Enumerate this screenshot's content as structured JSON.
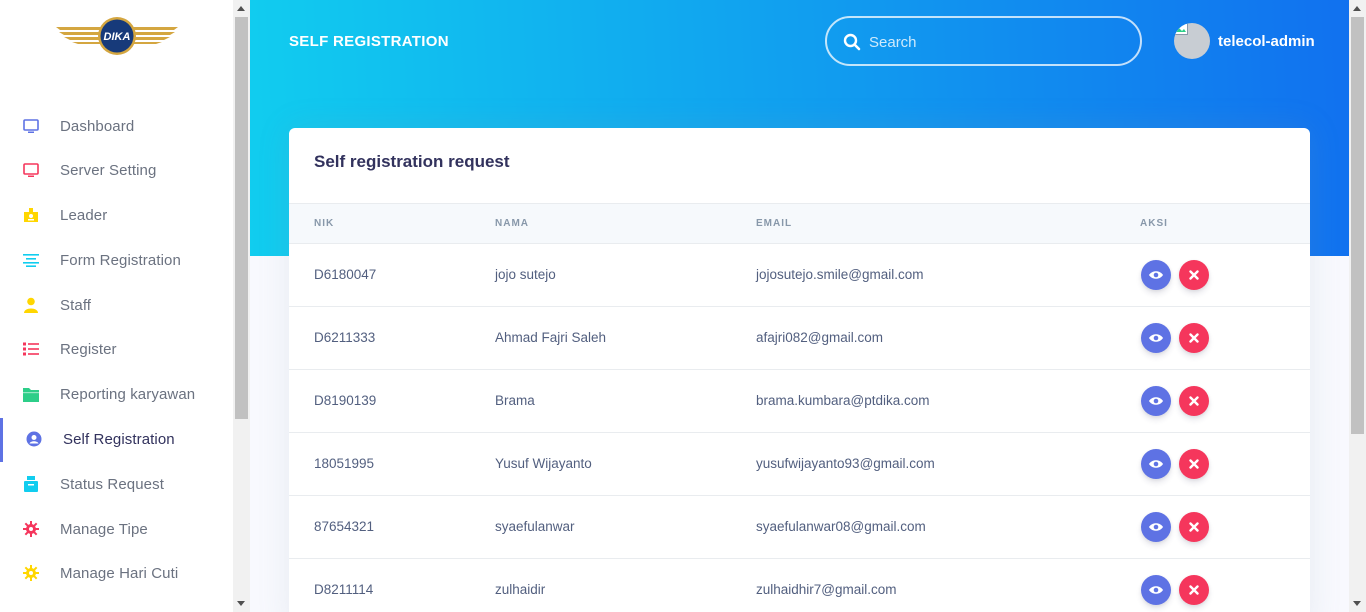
{
  "brand": {
    "logo_text": "DIKA"
  },
  "sidebar": {
    "items": [
      {
        "label": "Dashboard",
        "icon": "monitor-icon",
        "color": "#5e72e4"
      },
      {
        "label": "Server Setting",
        "icon": "monitor-icon",
        "color": "#f5365c"
      },
      {
        "label": "Leader",
        "icon": "badge-icon",
        "color": "#ffd600"
      },
      {
        "label": "Form Registration",
        "icon": "align-icon",
        "color": "#11cdef"
      },
      {
        "label": "Staff",
        "icon": "user-icon",
        "color": "#ffd600"
      },
      {
        "label": "Register",
        "icon": "list-icon",
        "color": "#f5365c"
      },
      {
        "label": "Reporting karyawan",
        "icon": "folder-icon",
        "color": "#2dce89"
      },
      {
        "label": "Self Registration",
        "icon": "user-circle-icon",
        "color": "#5e72e4",
        "active": true
      },
      {
        "label": "Status Request",
        "icon": "archive-icon",
        "color": "#11cdef"
      },
      {
        "label": "Manage Tipe",
        "icon": "gear-icon",
        "color": "#f5365c"
      },
      {
        "label": "Manage Hari Cuti",
        "icon": "gear-icon",
        "color": "#ffd600"
      }
    ]
  },
  "header": {
    "title": "SELF REGISTRATION",
    "search_placeholder": "Search",
    "username": "telecol-admin"
  },
  "card": {
    "title": "Self registration request",
    "columns": [
      "NIK",
      "NAMA",
      "EMAIL",
      "AKSI"
    ],
    "rows": [
      {
        "nik": "D6180047",
        "nama": "jojo sutejo",
        "email": "jojosutejo.smile@gmail.com"
      },
      {
        "nik": "D6211333",
        "nama": "Ahmad Fajri Saleh",
        "email": "afajri082@gmail.com"
      },
      {
        "nik": "D8190139",
        "nama": "Brama",
        "email": "brama.kumbara@ptdika.com"
      },
      {
        "nik": "18051995",
        "nama": "Yusuf Wijayanto",
        "email": "yusufwijayanto93@gmail.com"
      },
      {
        "nik": "87654321",
        "nama": "syaefulanwar",
        "email": "syaefulanwar08@gmail.com"
      },
      {
        "nik": "D8211114",
        "nama": "zulhaidir",
        "email": "zulhaidhir7@gmail.com"
      }
    ]
  },
  "colors": {
    "primary": "#5e72e4",
    "danger": "#f5365c",
    "gradient_start": "#11cdef",
    "gradient_end": "#1171ef"
  }
}
